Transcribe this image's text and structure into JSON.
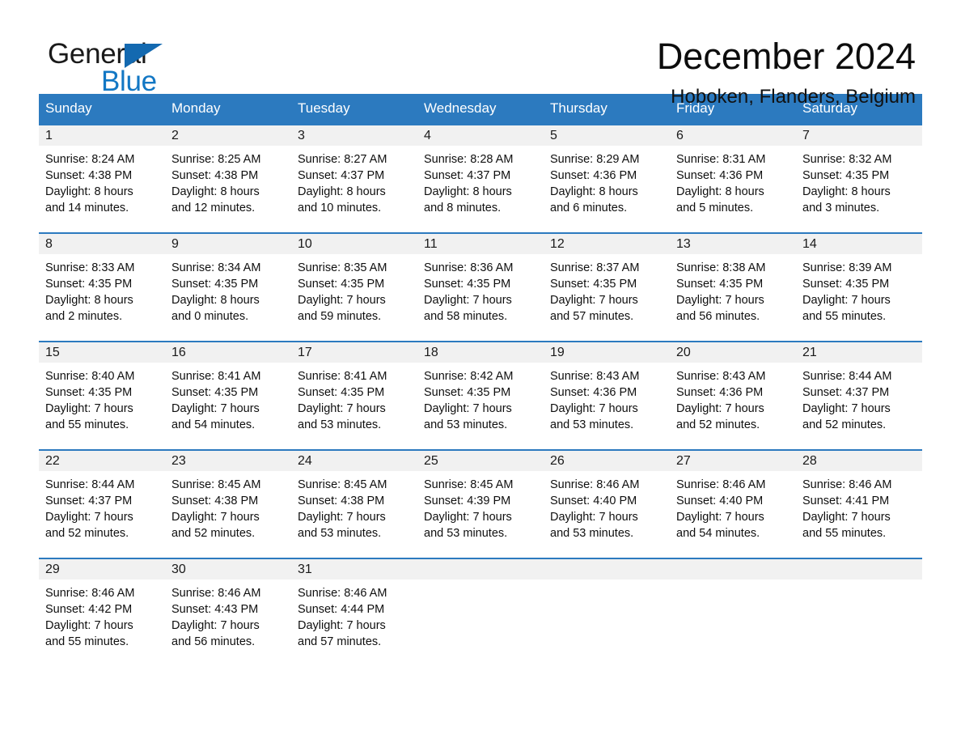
{
  "brand": {
    "name_line1": "General",
    "name_line2": "Blue",
    "triangle_color": "#1369b0",
    "blue_color": "#1277c4"
  },
  "header": {
    "month_title": "December 2024",
    "location": "Hoboken, Flanders, Belgium"
  },
  "calendar": {
    "accent_color": "#2c7abf",
    "daynum_bg": "#f1f1f1",
    "weekday_headers": [
      "Sunday",
      "Monday",
      "Tuesday",
      "Wednesday",
      "Thursday",
      "Friday",
      "Saturday"
    ],
    "weeks": [
      [
        {
          "day": "1",
          "sunrise": "Sunrise: 8:24 AM",
          "sunset": "Sunset: 4:38 PM",
          "daylight_line1": "Daylight: 8 hours",
          "daylight_line2": "and 14 minutes."
        },
        {
          "day": "2",
          "sunrise": "Sunrise: 8:25 AM",
          "sunset": "Sunset: 4:38 PM",
          "daylight_line1": "Daylight: 8 hours",
          "daylight_line2": "and 12 minutes."
        },
        {
          "day": "3",
          "sunrise": "Sunrise: 8:27 AM",
          "sunset": "Sunset: 4:37 PM",
          "daylight_line1": "Daylight: 8 hours",
          "daylight_line2": "and 10 minutes."
        },
        {
          "day": "4",
          "sunrise": "Sunrise: 8:28 AM",
          "sunset": "Sunset: 4:37 PM",
          "daylight_line1": "Daylight: 8 hours",
          "daylight_line2": "and 8 minutes."
        },
        {
          "day": "5",
          "sunrise": "Sunrise: 8:29 AM",
          "sunset": "Sunset: 4:36 PM",
          "daylight_line1": "Daylight: 8 hours",
          "daylight_line2": "and 6 minutes."
        },
        {
          "day": "6",
          "sunrise": "Sunrise: 8:31 AM",
          "sunset": "Sunset: 4:36 PM",
          "daylight_line1": "Daylight: 8 hours",
          "daylight_line2": "and 5 minutes."
        },
        {
          "day": "7",
          "sunrise": "Sunrise: 8:32 AM",
          "sunset": "Sunset: 4:35 PM",
          "daylight_line1": "Daylight: 8 hours",
          "daylight_line2": "and 3 minutes."
        }
      ],
      [
        {
          "day": "8",
          "sunrise": "Sunrise: 8:33 AM",
          "sunset": "Sunset: 4:35 PM",
          "daylight_line1": "Daylight: 8 hours",
          "daylight_line2": "and 2 minutes."
        },
        {
          "day": "9",
          "sunrise": "Sunrise: 8:34 AM",
          "sunset": "Sunset: 4:35 PM",
          "daylight_line1": "Daylight: 8 hours",
          "daylight_line2": "and 0 minutes."
        },
        {
          "day": "10",
          "sunrise": "Sunrise: 8:35 AM",
          "sunset": "Sunset: 4:35 PM",
          "daylight_line1": "Daylight: 7 hours",
          "daylight_line2": "and 59 minutes."
        },
        {
          "day": "11",
          "sunrise": "Sunrise: 8:36 AM",
          "sunset": "Sunset: 4:35 PM",
          "daylight_line1": "Daylight: 7 hours",
          "daylight_line2": "and 58 minutes."
        },
        {
          "day": "12",
          "sunrise": "Sunrise: 8:37 AM",
          "sunset": "Sunset: 4:35 PM",
          "daylight_line1": "Daylight: 7 hours",
          "daylight_line2": "and 57 minutes."
        },
        {
          "day": "13",
          "sunrise": "Sunrise: 8:38 AM",
          "sunset": "Sunset: 4:35 PM",
          "daylight_line1": "Daylight: 7 hours",
          "daylight_line2": "and 56 minutes."
        },
        {
          "day": "14",
          "sunrise": "Sunrise: 8:39 AM",
          "sunset": "Sunset: 4:35 PM",
          "daylight_line1": "Daylight: 7 hours",
          "daylight_line2": "and 55 minutes."
        }
      ],
      [
        {
          "day": "15",
          "sunrise": "Sunrise: 8:40 AM",
          "sunset": "Sunset: 4:35 PM",
          "daylight_line1": "Daylight: 7 hours",
          "daylight_line2": "and 55 minutes."
        },
        {
          "day": "16",
          "sunrise": "Sunrise: 8:41 AM",
          "sunset": "Sunset: 4:35 PM",
          "daylight_line1": "Daylight: 7 hours",
          "daylight_line2": "and 54 minutes."
        },
        {
          "day": "17",
          "sunrise": "Sunrise: 8:41 AM",
          "sunset": "Sunset: 4:35 PM",
          "daylight_line1": "Daylight: 7 hours",
          "daylight_line2": "and 53 minutes."
        },
        {
          "day": "18",
          "sunrise": "Sunrise: 8:42 AM",
          "sunset": "Sunset: 4:35 PM",
          "daylight_line1": "Daylight: 7 hours",
          "daylight_line2": "and 53 minutes."
        },
        {
          "day": "19",
          "sunrise": "Sunrise: 8:43 AM",
          "sunset": "Sunset: 4:36 PM",
          "daylight_line1": "Daylight: 7 hours",
          "daylight_line2": "and 53 minutes."
        },
        {
          "day": "20",
          "sunrise": "Sunrise: 8:43 AM",
          "sunset": "Sunset: 4:36 PM",
          "daylight_line1": "Daylight: 7 hours",
          "daylight_line2": "and 52 minutes."
        },
        {
          "day": "21",
          "sunrise": "Sunrise: 8:44 AM",
          "sunset": "Sunset: 4:37 PM",
          "daylight_line1": "Daylight: 7 hours",
          "daylight_line2": "and 52 minutes."
        }
      ],
      [
        {
          "day": "22",
          "sunrise": "Sunrise: 8:44 AM",
          "sunset": "Sunset: 4:37 PM",
          "daylight_line1": "Daylight: 7 hours",
          "daylight_line2": "and 52 minutes."
        },
        {
          "day": "23",
          "sunrise": "Sunrise: 8:45 AM",
          "sunset": "Sunset: 4:38 PM",
          "daylight_line1": "Daylight: 7 hours",
          "daylight_line2": "and 52 minutes."
        },
        {
          "day": "24",
          "sunrise": "Sunrise: 8:45 AM",
          "sunset": "Sunset: 4:38 PM",
          "daylight_line1": "Daylight: 7 hours",
          "daylight_line2": "and 53 minutes."
        },
        {
          "day": "25",
          "sunrise": "Sunrise: 8:45 AM",
          "sunset": "Sunset: 4:39 PM",
          "daylight_line1": "Daylight: 7 hours",
          "daylight_line2": "and 53 minutes."
        },
        {
          "day": "26",
          "sunrise": "Sunrise: 8:46 AM",
          "sunset": "Sunset: 4:40 PM",
          "daylight_line1": "Daylight: 7 hours",
          "daylight_line2": "and 53 minutes."
        },
        {
          "day": "27",
          "sunrise": "Sunrise: 8:46 AM",
          "sunset": "Sunset: 4:40 PM",
          "daylight_line1": "Daylight: 7 hours",
          "daylight_line2": "and 54 minutes."
        },
        {
          "day": "28",
          "sunrise": "Sunrise: 8:46 AM",
          "sunset": "Sunset: 4:41 PM",
          "daylight_line1": "Daylight: 7 hours",
          "daylight_line2": "and 55 minutes."
        }
      ],
      [
        {
          "day": "29",
          "sunrise": "Sunrise: 8:46 AM",
          "sunset": "Sunset: 4:42 PM",
          "daylight_line1": "Daylight: 7 hours",
          "daylight_line2": "and 55 minutes."
        },
        {
          "day": "30",
          "sunrise": "Sunrise: 8:46 AM",
          "sunset": "Sunset: 4:43 PM",
          "daylight_line1": "Daylight: 7 hours",
          "daylight_line2": "and 56 minutes."
        },
        {
          "day": "31",
          "sunrise": "Sunrise: 8:46 AM",
          "sunset": "Sunset: 4:44 PM",
          "daylight_line1": "Daylight: 7 hours",
          "daylight_line2": "and 57 minutes."
        },
        {
          "day": "",
          "sunrise": "",
          "sunset": "",
          "daylight_line1": "",
          "daylight_line2": ""
        },
        {
          "day": "",
          "sunrise": "",
          "sunset": "",
          "daylight_line1": "",
          "daylight_line2": ""
        },
        {
          "day": "",
          "sunrise": "",
          "sunset": "",
          "daylight_line1": "",
          "daylight_line2": ""
        },
        {
          "day": "",
          "sunrise": "",
          "sunset": "",
          "daylight_line1": "",
          "daylight_line2": ""
        }
      ]
    ]
  }
}
